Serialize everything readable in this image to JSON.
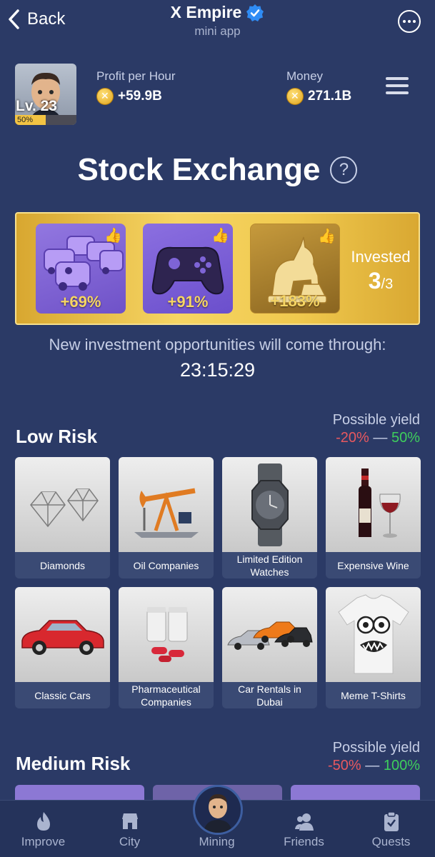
{
  "header": {
    "back_label": "Back",
    "title": "X Empire",
    "subtitle": "mini app"
  },
  "profile": {
    "level": "Lv. 23",
    "progress_label": "50%",
    "progress": 0.5,
    "profit_label": "Profit per Hour",
    "profit_value": "+59.9B",
    "money_label": "Money",
    "money_value": "271.1B"
  },
  "page_title": "Stock Exchange",
  "invested": {
    "items": [
      {
        "name": "vans",
        "percent": "+69%"
      },
      {
        "name": "gamepad",
        "percent": "+91%"
      },
      {
        "name": "unicorn-statue",
        "percent": "+183%"
      }
    ],
    "label": "Invested",
    "count": "3",
    "total": "/3"
  },
  "notice": "New investment opportunities will come through:",
  "timer": "23:15:29",
  "low_risk": {
    "title": "Low Risk",
    "yield_label": "Possible yield",
    "yield_min": "-20%",
    "yield_sep": "—",
    "yield_max": "50%",
    "cards": [
      {
        "label": "Diamonds",
        "icon": "diamond-icon"
      },
      {
        "label": "Oil Companies",
        "icon": "oil-pump-icon"
      },
      {
        "label": "Limited Edition Watches",
        "icon": "watch-icon"
      },
      {
        "label": "Expensive Wine",
        "icon": "wine-icon"
      },
      {
        "label": "Classic Cars",
        "icon": "classic-car-icon"
      },
      {
        "label": "Pharmaceutical Companies",
        "icon": "pills-icon"
      },
      {
        "label": "Car Rentals in Dubai",
        "icon": "sports-cars-icon"
      },
      {
        "label": "Meme T-Shirts",
        "icon": "tshirt-icon"
      }
    ]
  },
  "medium_risk": {
    "title": "Medium Risk",
    "yield_label": "Possible yield",
    "yield_min": "-50%",
    "yield_sep": "—",
    "yield_max": "100%"
  },
  "nav": {
    "improve": "Improve",
    "city": "City",
    "mining": "Mining",
    "friends": "Friends",
    "quests": "Quests"
  },
  "colors": {
    "background": "#2b3a66",
    "gold": "#f6d563",
    "negative": "#e8585f",
    "positive": "#3ecf5c"
  }
}
